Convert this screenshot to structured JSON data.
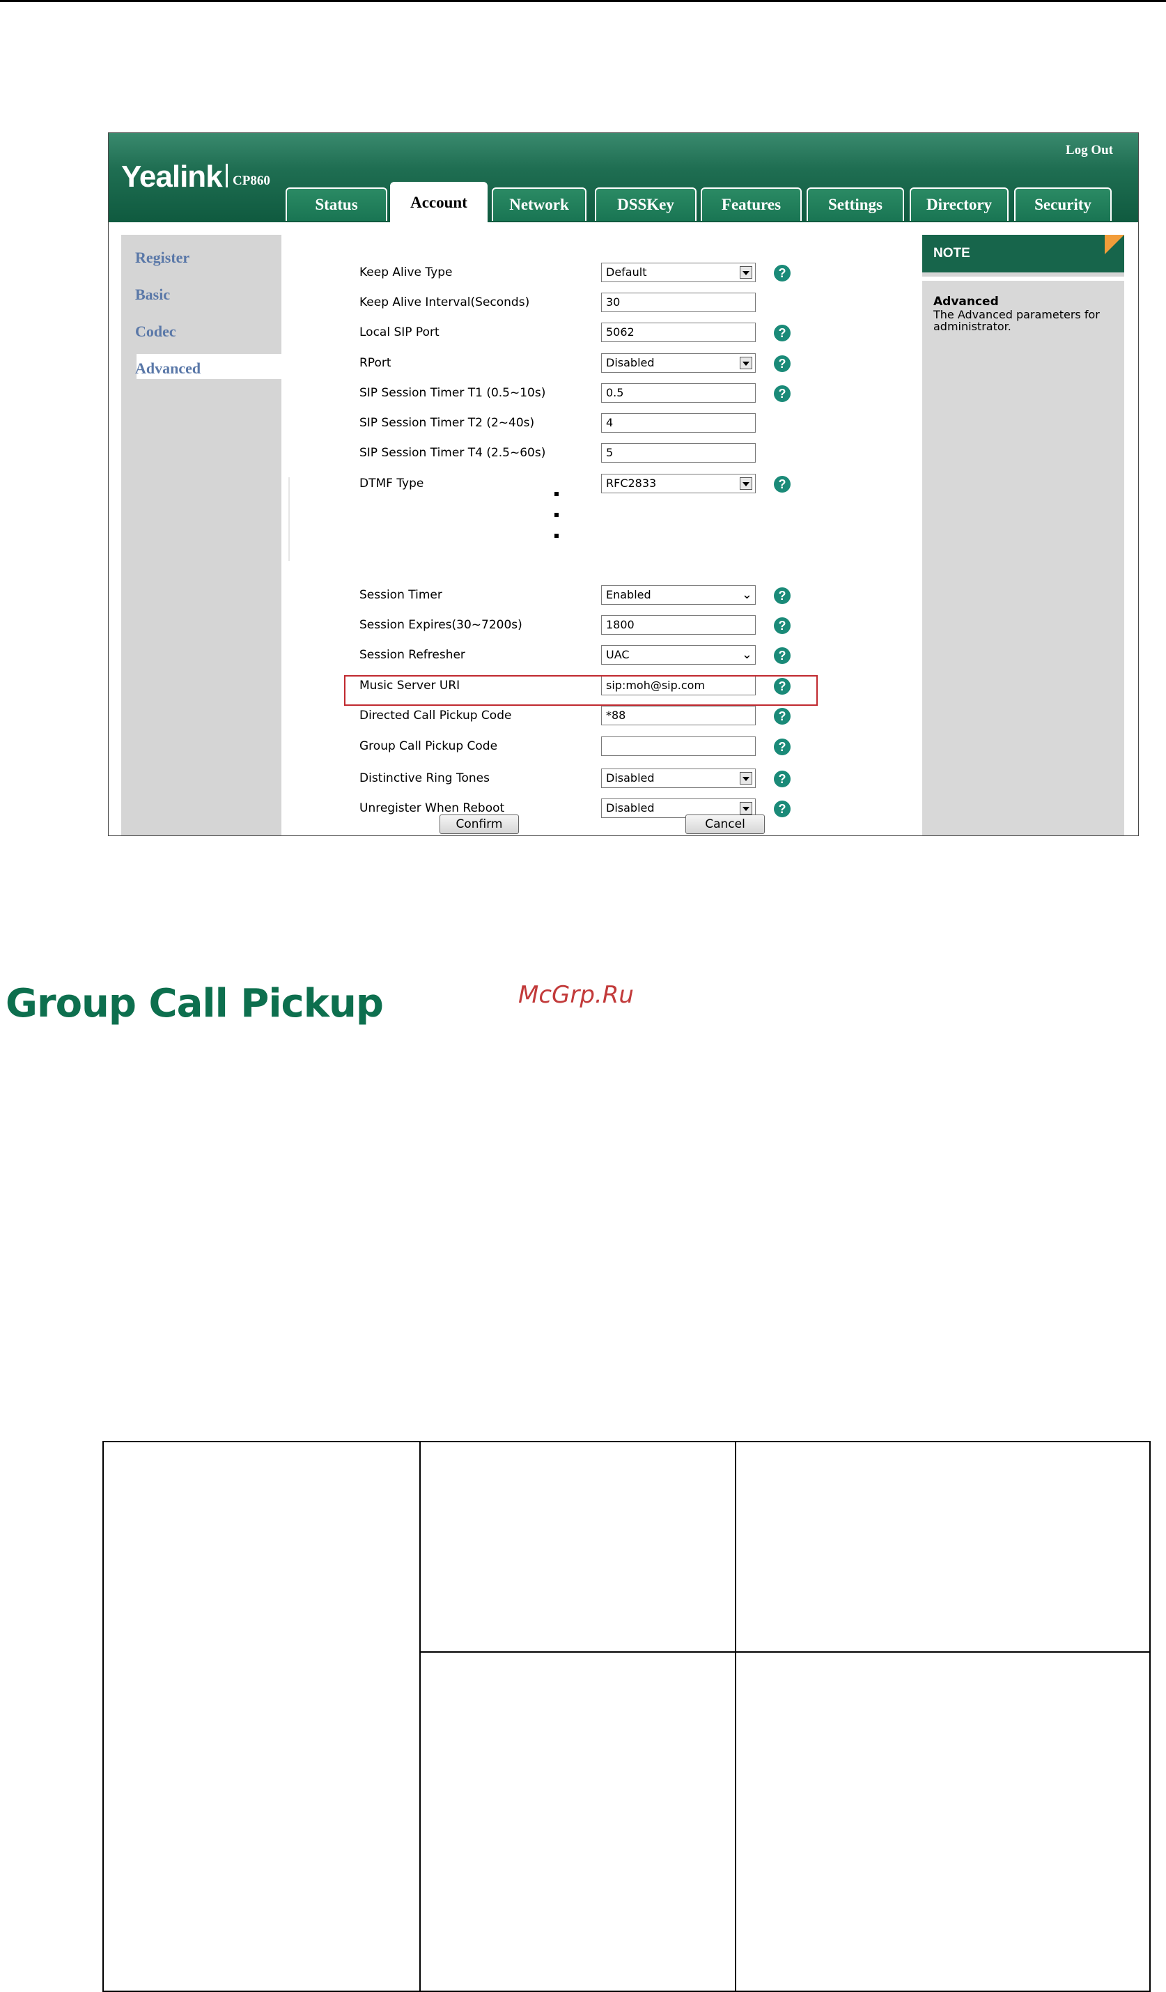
{
  "app": {
    "logo": "Yealink",
    "model": "CP860",
    "logout": "Log Out"
  },
  "tabs": [
    "Status",
    "Account",
    "Network",
    "DSSKey",
    "Features",
    "Settings",
    "Directory",
    "Security"
  ],
  "sidebar": [
    "Register",
    "Basic",
    "Codec",
    "Advanced"
  ],
  "settings_top": [
    {
      "label": "Keep Alive Type",
      "value": "Default",
      "kind": "select",
      "help": true
    },
    {
      "label": "Keep Alive Interval(Seconds)",
      "value": "30",
      "kind": "input",
      "help": false
    },
    {
      "label": "Local SIP Port",
      "value": "5062",
      "kind": "input",
      "help": true
    },
    {
      "label": "RPort",
      "value": "Disabled",
      "kind": "select",
      "help": true
    },
    {
      "label": "SIP Session Timer T1 (0.5~10s)",
      "value": "0.5",
      "kind": "input",
      "help": true
    },
    {
      "label": "SIP Session Timer T2 (2~40s)",
      "value": "4",
      "kind": "input",
      "help": false
    },
    {
      "label": "SIP Session Timer T4 (2.5~60s)",
      "value": "5",
      "kind": "input",
      "help": false
    },
    {
      "label": "DTMF Type",
      "value": "RFC2833",
      "kind": "select",
      "help": true
    }
  ],
  "settings_bottom": [
    {
      "label": "Session Timer",
      "value": "Enabled",
      "kind": "dropdown",
      "help": true
    },
    {
      "label": "Session Expires(30~7200s)",
      "value": "1800",
      "kind": "input",
      "help": true
    },
    {
      "label": "Session Refresher",
      "value": "UAC",
      "kind": "dropdown",
      "help": true
    },
    {
      "label": "Music Server URI",
      "value": "sip:moh@sip.com",
      "kind": "input",
      "help": true
    },
    {
      "label": "Directed Call Pickup Code",
      "value": "*88",
      "kind": "input",
      "help": true
    },
    {
      "label": "Group Call Pickup Code",
      "value": "",
      "kind": "input",
      "help": true
    },
    {
      "label": "Distinctive Ring Tones",
      "value": "Disabled",
      "kind": "select",
      "help": true
    },
    {
      "label": "Unregister When Reboot",
      "value": "Disabled",
      "kind": "select",
      "help": true
    }
  ],
  "buttons": {
    "confirm": "Confirm",
    "cancel": "Cancel"
  },
  "note": {
    "header": "NOTE",
    "title": "Advanced",
    "text": "The Advanced parameters for administrator."
  },
  "heading": "Group Call Pickup",
  "watermark": "McGrp.Ru",
  "help_glyph": "?",
  "colors": {
    "brand_green": "#17654b",
    "highlight_red": "#c0292f",
    "help_teal": "#1a8a78"
  }
}
